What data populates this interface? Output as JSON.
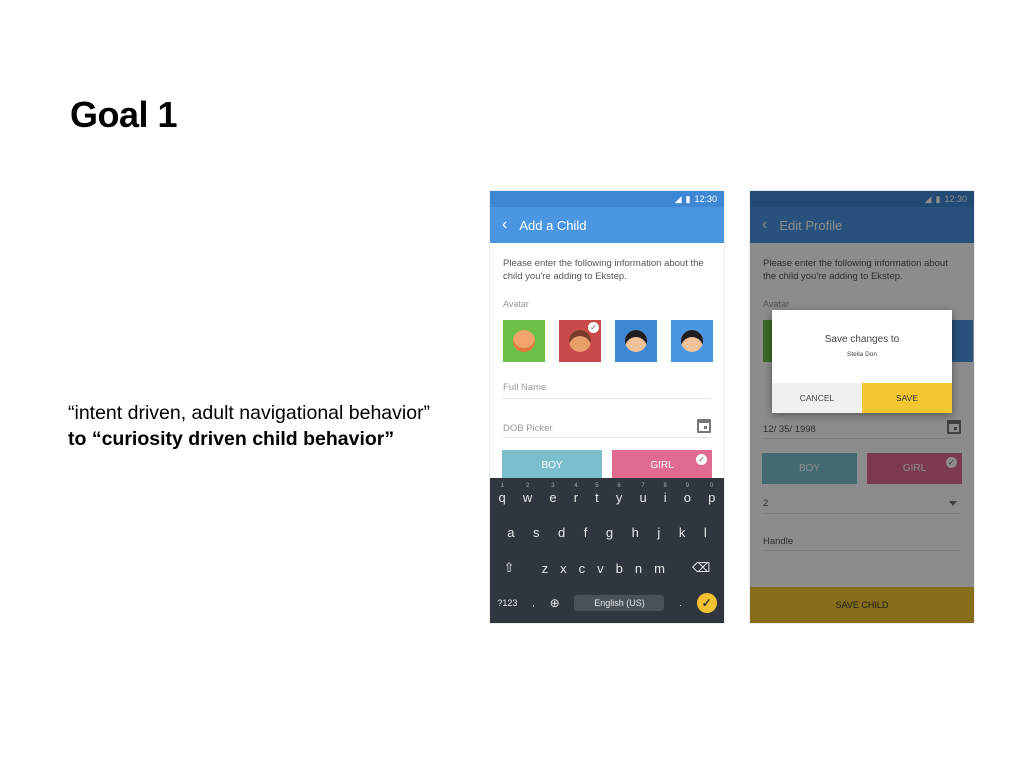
{
  "slide": {
    "title": "Goal 1",
    "quote_plain": "“intent driven, adult navigational behavior”",
    "quote_bold": "to “curiosity driven child behavior”"
  },
  "phone1": {
    "status_time": "12:30",
    "appbar_title": "Add a Child",
    "intro": "Please enter the following information about the child you're adding to Ekstep.",
    "avatar_label": "Avatar",
    "avatars": [
      {
        "bg": "#6cc04a",
        "face": "#f2a46b"
      },
      {
        "bg": "#c94a4a",
        "face": "#e8a06a"
      },
      {
        "bg": "#3d87d4",
        "face": "#f0c29a"
      },
      {
        "bg": "#4a96e3",
        "face": "#f0c29a"
      }
    ],
    "full_name_placeholder": "Full Name",
    "dob_placeholder": "DOB Picker",
    "boy_label": "BOY",
    "girl_label": "GIRL",
    "keyboard": {
      "row1": [
        "q",
        "w",
        "e",
        "r",
        "t",
        "y",
        "u",
        "i",
        "o",
        "p"
      ],
      "row1_nums": [
        "1",
        "2",
        "3",
        "4",
        "5",
        "6",
        "7",
        "8",
        "9",
        "0"
      ],
      "row2": [
        "a",
        "s",
        "d",
        "f",
        "g",
        "h",
        "j",
        "k",
        "l"
      ],
      "row3": [
        "z",
        "x",
        "c",
        "v",
        "b",
        "n",
        "m"
      ],
      "sym_label": "?123",
      "comma": ",",
      "space_label": "English (US)",
      "period": "."
    }
  },
  "phone2": {
    "status_time": "12:30",
    "appbar_title": "Edit Profile",
    "intro": "Please enter the following information about the child you're adding to Ekstep.",
    "avatar_label": "Avatar",
    "dob_value": "12/ 35/ 1998",
    "boy_label": "BOY",
    "girl_label": "GIRL",
    "class_value": "2",
    "handle_placeholder": "Handle",
    "save_child_label": "SAVE CHILD",
    "dialog": {
      "title": "Save changes to",
      "subtitle": "Stella Don",
      "cancel_label": "CANCEL",
      "save_label": "SAVE"
    }
  },
  "colors": {
    "appbar": "#4a96e3",
    "statusbar": "#3d87d4",
    "boy": "#7bbfcf",
    "girl": "#e06b8f",
    "accent_yellow": "#f3c730",
    "keyboard_bg": "#2f363d"
  }
}
